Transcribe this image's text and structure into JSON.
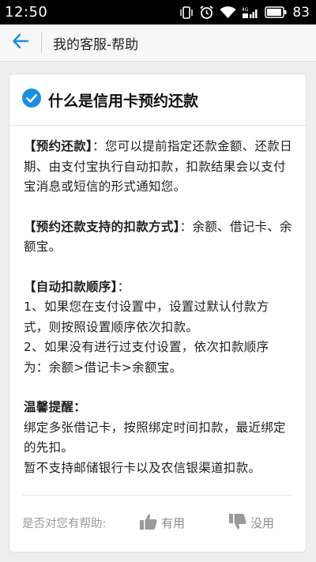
{
  "status_bar": {
    "time": "12:50",
    "battery_percent": "83",
    "icons": [
      "vibrate-icon",
      "alarm-icon",
      "wifi-icon",
      "signal-icon",
      "battery-icon"
    ]
  },
  "app_bar": {
    "back_icon": "back-arrow-icon",
    "title": "我的客服-帮助"
  },
  "article": {
    "check_icon": "check-circle-icon",
    "title": "什么是信用卡预约还款",
    "p1_bold": "【预约还款】",
    "p1_text": "：您可以提前指定还款金额、还款日期、由支付宝执行自动扣款，扣款结果会以支付宝消息或短信的形式通知您。",
    "p2_bold": "【预约还款支持的扣款方式】",
    "p2_text": "：余额、借记卡、余额宝。",
    "p3_bold": "【自动扣款顺序】",
    "p3_text": "：",
    "p3_line1": "1、如果您在支付设置中，设置过默认付款方式，则按照设置顺序依次扣款。",
    "p3_line2": "2、如果没有进行过支付设置，依次扣款顺序为：余额>借记卡>余额宝。",
    "p4_bold": "温馨提醒：",
    "p4_line1": "绑定多张借记卡，按照绑定时间扣款，最近绑定的先扣。",
    "p4_line2": "暂不支持邮储银行卡以及农信银渠道扣款。"
  },
  "feedback": {
    "question": "是否对您有帮助:",
    "yes_label": "有用",
    "no_label": "没用",
    "yes_icon": "thumbs-up-icon",
    "no_icon": "thumbs-down-icon"
  },
  "colors": {
    "accent": "#1a8ee1",
    "status_bar_bg": "#000000",
    "page_bg": "#eeeeee"
  }
}
